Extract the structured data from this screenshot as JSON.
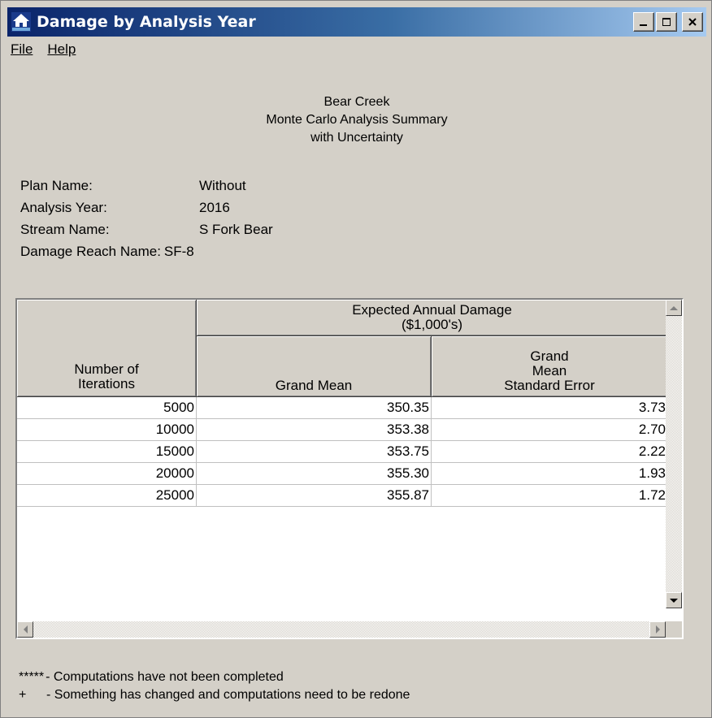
{
  "window": {
    "title": "Damage by Analysis Year",
    "icon": "app-house-icon",
    "controls": [
      "minimize-icon",
      "maximize-icon",
      "close-icon"
    ]
  },
  "menu": {
    "file_label": "File",
    "help_label": "Help"
  },
  "header": {
    "line1": "Bear Creek",
    "line2": "Monte Carlo Analysis Summary",
    "line3": "with Uncertainty"
  },
  "info": {
    "plan_label": "Plan Name:",
    "plan_value": "Without",
    "year_label": "Analysis Year:",
    "year_value": "2016",
    "stream_label": "Stream Name:",
    "stream_value": "S Fork Bear",
    "reach_label": "Damage Reach Name:",
    "reach_value": "SF-8"
  },
  "grid": {
    "group_header_line1": "Expected Annual Damage",
    "group_header_line2": "($1,000's)",
    "col1_line1": "Number of",
    "col1_line2": "Iterations",
    "col2": "Grand Mean",
    "col3_line1": "Grand",
    "col3_line2": "Mean",
    "col3_line3": "Standard Error",
    "rows": [
      {
        "iterations": "5000",
        "mean": "350.35",
        "se": "3.73"
      },
      {
        "iterations": "10000",
        "mean": "353.38",
        "se": "2.70"
      },
      {
        "iterations": "15000",
        "mean": "353.75",
        "se": "2.22"
      },
      {
        "iterations": "20000",
        "mean": "355.30",
        "se": "1.93"
      },
      {
        "iterations": "25000",
        "mean": "355.87",
        "se": "1.72"
      }
    ]
  },
  "legend": {
    "sym1": "*****",
    "text1": "- Computations have not been completed",
    "sym2": "+",
    "text2": "- Something has changed and computations need to be redone"
  }
}
